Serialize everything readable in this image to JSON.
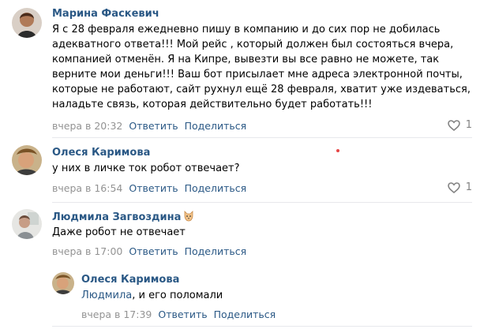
{
  "comments": [
    {
      "author": "Марина Фаскевич",
      "lines": [
        "Я с 28 февраля ежедневно пишу в компанию и до сих пор не добилась",
        "адекватного ответа!!! Мой рейс , который должен был состояться вчера,",
        "компанией отменён. Я на Кипре, вывезти вы все равно не можете, так",
        "верните мои деньги!!! Ваш бот присылает мне адреса электронной почты,",
        "которые не работают, сайт рухнул ещё 28 февраля, хватит уже издеваться,",
        "наладьте связь, которая действительно будет работать!!!"
      ],
      "date": "вчера в 20:32",
      "reply_label": "Ответить",
      "share_label": "Поделиться",
      "likes": "1"
    },
    {
      "author": "Олеся Каримова",
      "lines": [
        "у них в личке ток робот отвечает?"
      ],
      "date": "вчера в 16:54",
      "reply_label": "Ответить",
      "share_label": "Поделиться",
      "likes": "1"
    },
    {
      "author": "Людмила Загвоздина",
      "author_badge": "cat-emoji",
      "lines": [
        "Даже робот не отвечает"
      ],
      "date": "вчера в 17:00",
      "reply_label": "Ответить",
      "share_label": "Поделиться"
    },
    {
      "author": "Олеся Каримова",
      "mention": "Людмила",
      "text_after_mention": ", и его поломали",
      "date": "вчера в 17:39",
      "reply_label": "Ответить",
      "share_label": "Поделиться"
    }
  ],
  "colors": {
    "link": "#2a5885",
    "meta": "#939393",
    "divider": "#e7e8ec",
    "like_icon": "#828282"
  },
  "icons": {
    "like": "heart-outline-icon"
  }
}
